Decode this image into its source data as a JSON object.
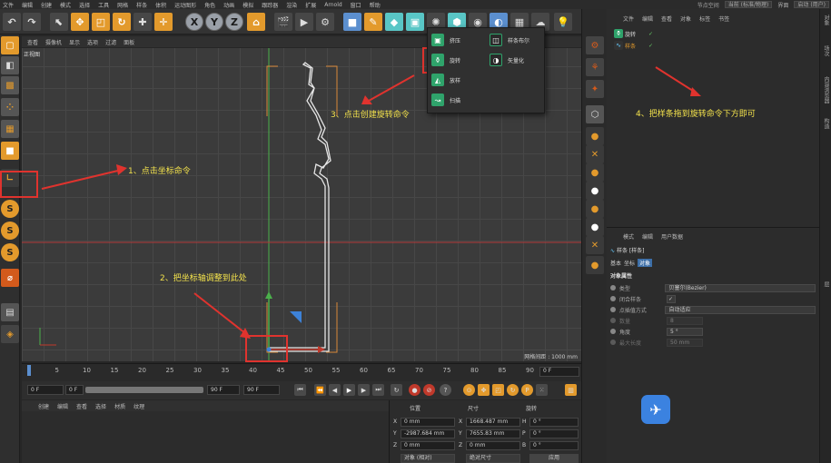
{
  "menubar": {
    "items": [
      "文件",
      "编辑",
      "创建",
      "模式",
      "选择",
      "工具",
      "网格",
      "样条",
      "体积",
      "运动图形",
      "角色",
      "动画",
      "模拟",
      "跟踪器",
      "渲染",
      "扩展",
      "Arnold",
      "窗口",
      "帮助"
    ],
    "node_space_label": "节点空间",
    "node_space_value": "当前 (标准/物理)",
    "interface_label": "界面",
    "interface_value": "启动 (用户)"
  },
  "toolbar": {
    "xyz_labels": [
      "X",
      "Y",
      "Z"
    ]
  },
  "viewport": {
    "menu": [
      "查看",
      "摄像机",
      "显示",
      "选项",
      "过滤",
      "面板"
    ],
    "label": "正视图",
    "grid_distance": "网格间距 : 1000 mm"
  },
  "popup": {
    "items": [
      "挤压",
      "旋转",
      "放样",
      "扫描",
      "样条布尔",
      "矢量化"
    ]
  },
  "annotations": {
    "step1": "1、点击坐标命令",
    "step2": "2、把坐标轴调整到此处",
    "step3": "3、点击创建旋转命令",
    "step4": "4、把样条拖到旋转命令下方即可"
  },
  "timeline": {
    "ticks": [
      "0",
      "5",
      "10",
      "15",
      "20",
      "25",
      "30",
      "35",
      "40",
      "45",
      "50",
      "55",
      "60",
      "65",
      "70",
      "75",
      "80",
      "85",
      "90"
    ],
    "current_frame": "0 F"
  },
  "transport": {
    "start_frame": "0 F",
    "preview_start": "0 F",
    "preview_end": "90 F",
    "end_frame": "90 F"
  },
  "material": {
    "menu": [
      "创建",
      "编辑",
      "查看",
      "选择",
      "材质",
      "纹理"
    ]
  },
  "coordinates": {
    "headers": [
      "位置",
      "尺寸",
      "旋转"
    ],
    "rows": [
      {
        "axis": "X",
        "pos": "0 mm",
        "size": "1668.487 mm",
        "rot_axis": "H",
        "rot": "0 °"
      },
      {
        "axis": "Y",
        "pos": "-2987.684 mm",
        "size": "7655.83 mm",
        "rot_axis": "P",
        "rot": "0 °"
      },
      {
        "axis": "Z",
        "pos": "0 mm",
        "size": "0 mm",
        "rot_axis": "B",
        "rot": "0 °"
      }
    ],
    "mode_object": "对象 (相对)",
    "mode_size": "绝对尺寸",
    "apply": "应用"
  },
  "object_manager": {
    "menu": [
      "文件",
      "编辑",
      "查看",
      "对象",
      "标签",
      "书签"
    ],
    "objects": [
      {
        "name": "旋转"
      },
      {
        "name": "样条"
      }
    ]
  },
  "attributes": {
    "menu": [
      "模式",
      "编辑",
      "用户数据"
    ],
    "object_title": "样条 [样条]",
    "tabs": [
      "基本",
      "坐标",
      "对象"
    ],
    "section": "对象属性",
    "rows": [
      {
        "label": "类型",
        "value": "贝塞尔(Bezier)"
      },
      {
        "label": "闭合样条",
        "value": "✓"
      },
      {
        "label": "点插值方式",
        "value": "自动适应"
      },
      {
        "label": "数量",
        "value": "8"
      },
      {
        "label": "角度",
        "value": "5 °"
      },
      {
        "label": "最大长度",
        "value": "50 mm"
      }
    ]
  },
  "side_tabs": [
    "对象",
    "场次",
    "内容浏览器",
    "构造",
    "层"
  ],
  "colors": {
    "accent_orange": "#e39a2c",
    "accent_blue": "#5b8fcf",
    "annotation_yellow": "#f2e14c",
    "annotation_red": "#e0332e",
    "generator_green": "#2fa36b"
  }
}
